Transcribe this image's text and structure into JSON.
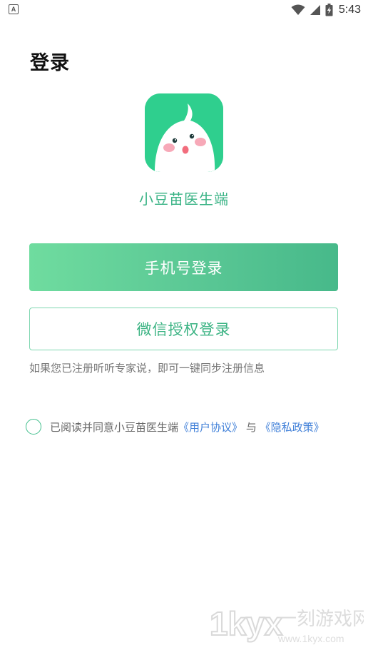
{
  "status_bar": {
    "app_icon_letter": "A",
    "time": "5:43",
    "icons": [
      "wifi-icon",
      "signal-icon",
      "battery-charging-icon"
    ]
  },
  "page": {
    "title": "登录"
  },
  "app": {
    "name": "小豆苗医生端",
    "logo_icon": "sprout-mascot-logo",
    "brand_color": "#2fcf8e"
  },
  "buttons": {
    "phone_login": "手机号登录",
    "wechat_login": "微信授权登录"
  },
  "hint": "如果您已注册听听专家说，即可一键同步注册信息",
  "agreement": {
    "prefix": "已阅读并同意小豆苗医生端",
    "user_agreement": "《用户协议》",
    "conjunction": "与",
    "privacy_policy": "《隐私政策》",
    "checked": false
  },
  "watermark": {
    "brand": "1kyx",
    "title": "一刻游戏网",
    "url": "www.1kyx.com"
  }
}
